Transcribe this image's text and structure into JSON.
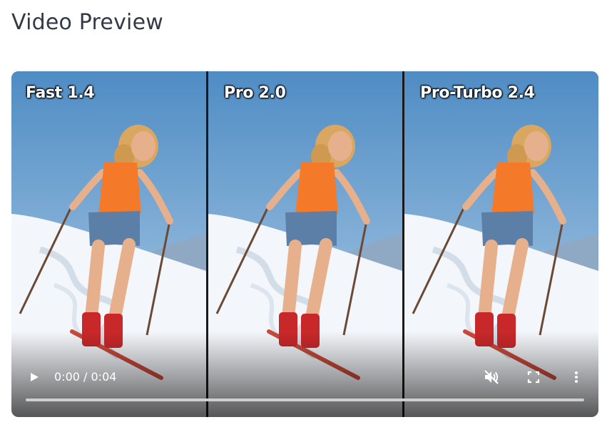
{
  "page": {
    "title": "Video Preview"
  },
  "video": {
    "panels": [
      {
        "label": "Fast 1.4"
      },
      {
        "label": "Pro 2.0"
      },
      {
        "label": "Pro-Turbo 2.4"
      }
    ],
    "time_display": "0:00 / 0:04",
    "progress": 0.0,
    "icons": {
      "play": "play-icon",
      "mute": "volume-muted-icon",
      "fullscreen": "fullscreen-icon",
      "more": "more-vertical-icon"
    },
    "colors": {
      "sky_top": "#5a95c9",
      "sky_bottom": "#b7d3ea",
      "snow": "#f2f5f9",
      "tank_top": "#f47a2a",
      "shorts": "#5b7fa6",
      "boots": "#c8282a",
      "skis": "#c94a3a",
      "hair": "#d9a760",
      "skin": "#e7b08c"
    }
  }
}
